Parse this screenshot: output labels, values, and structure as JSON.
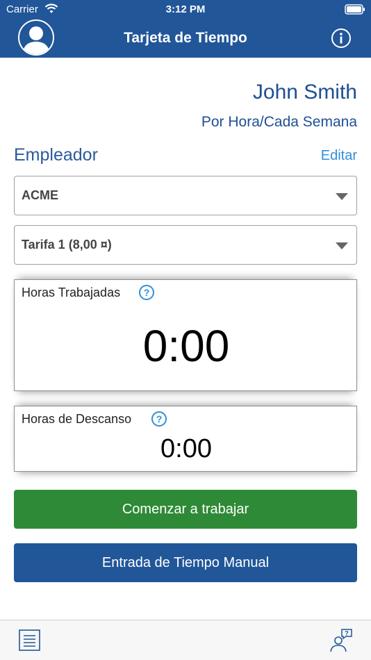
{
  "status_bar": {
    "carrier": "Carrier",
    "time": "3:12 PM",
    "wifi_icon": "wifi-icon",
    "battery_icon": "battery-icon"
  },
  "nav": {
    "title": "Tarjeta de Tiempo",
    "avatar_icon": "user-avatar-icon",
    "info_icon": "info-icon"
  },
  "employee": {
    "name": "John Smith",
    "pay_type": "Por Hora/Cada Semana"
  },
  "employer_section": {
    "label": "Empleador",
    "edit_label": "Editar"
  },
  "selects": {
    "employer_value": "ACME",
    "rate_value": "Tarifa 1 (8,00 ¤)"
  },
  "hours_worked": {
    "label": "Horas Trabajadas",
    "value": "0:00"
  },
  "break_hours": {
    "label": "Horas de Descanso",
    "value": "0:00"
  },
  "buttons": {
    "start_work": "Comenzar a trabajar",
    "manual_entry": "Entrada de Tiempo Manual"
  },
  "tab_bar": {
    "left_icon": "list-icon",
    "right_icon": "support-icon"
  },
  "colors": {
    "header_blue": "#215699",
    "text_blue": "#1e4f93",
    "link_blue": "#2f8fd8",
    "start_green": "#2e8a36"
  }
}
